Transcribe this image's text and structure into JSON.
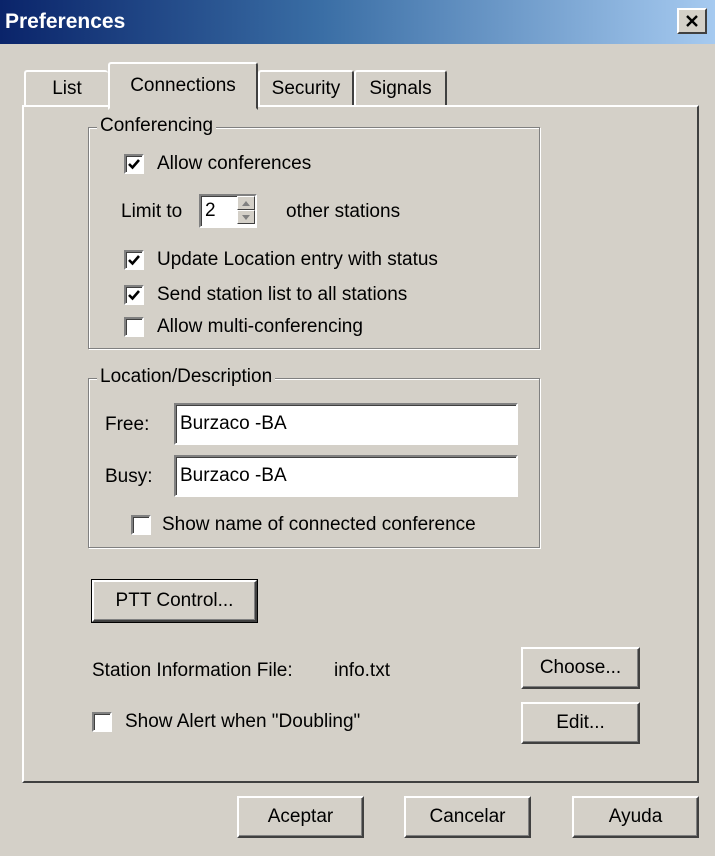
{
  "window": {
    "title": "Preferences"
  },
  "tabs": [
    {
      "label": "List",
      "active": false
    },
    {
      "label": "Connections",
      "active": true
    },
    {
      "label": "Security",
      "active": false
    },
    {
      "label": "Signals",
      "active": false
    }
  ],
  "conferencing": {
    "legend": "Conferencing",
    "allow_conferences": {
      "label": "Allow conferences",
      "checked": true
    },
    "limit_prefix": "Limit to",
    "limit_value": "2",
    "limit_suffix": "other stations",
    "update_location": {
      "label": "Update Location entry with status",
      "checked": true
    },
    "send_station_list": {
      "label": "Send station list to all stations",
      "checked": true
    },
    "allow_multi": {
      "label": "Allow multi-conferencing",
      "checked": false
    }
  },
  "location": {
    "legend": "Location/Description",
    "free_label": "Free:",
    "free_value": "Burzaco -BA",
    "busy_label": "Busy:",
    "busy_value": "Burzaco -BA",
    "show_name": {
      "label": "Show name of connected conference",
      "checked": false
    }
  },
  "ptt_button": "PTT Control...",
  "station_info": {
    "label": "Station Information File:",
    "file": "info.txt",
    "choose_button": "Choose...",
    "edit_button": "Edit..."
  },
  "show_alert": {
    "label": "Show Alert when \"Doubling\"",
    "checked": false
  },
  "footer": {
    "ok": "Aceptar",
    "cancel": "Cancelar",
    "help": "Ayuda"
  },
  "icons": {
    "close": "close-icon",
    "check": "checkmark-icon",
    "spin_up": "arrow-up-icon",
    "spin_down": "arrow-down-icon"
  }
}
